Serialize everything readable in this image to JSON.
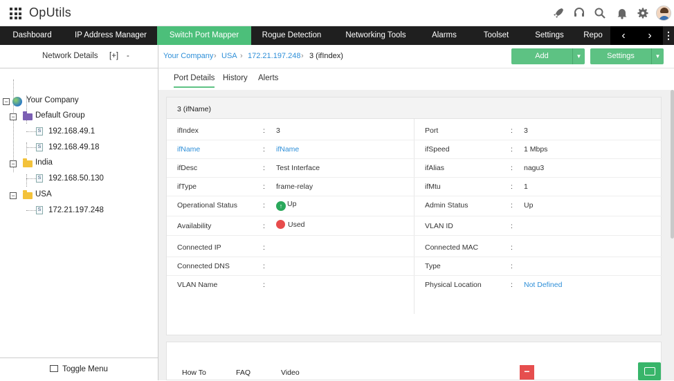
{
  "app": {
    "title": "OpUtils"
  },
  "header_icons": [
    "rocket-icon",
    "headset-icon",
    "search-icon",
    "bell-icon",
    "gear-icon"
  ],
  "nav": {
    "items": [
      "Dashboard",
      "IP Address Manager",
      "Switch Port Mapper",
      "Rogue Detection",
      "Networking Tools",
      "Alarms",
      "Toolset",
      "Settings",
      "Repo"
    ],
    "active": "Switch Port Mapper",
    "prev_arrow": "‹",
    "next_arrow": "›",
    "more": "⋮"
  },
  "sidebar": {
    "title": "Network Details",
    "expand": "[+]",
    "collapse": "-",
    "tree": {
      "root": "Your Company",
      "groups": [
        {
          "label": "Default Group",
          "color": "#7b5fb3",
          "children": [
            "192.168.49.1",
            "192.168.49.18"
          ]
        },
        {
          "label": "India",
          "color": "#f3c23a",
          "children": [
            "192.168.50.130"
          ]
        },
        {
          "label": "USA",
          "color": "#f3c23a",
          "children": [
            "172.21.197.248"
          ]
        }
      ]
    },
    "toggle_menu": "Toggle Menu"
  },
  "breadcrumb": {
    "items": [
      "Your Company",
      "USA",
      "172.21.197.248"
    ],
    "current": "3 (ifIndex)"
  },
  "buttons": {
    "add": "Add",
    "settings": "Settings"
  },
  "tabs": {
    "items": [
      "Port Details",
      "History",
      "Alerts"
    ],
    "active": "Port Details"
  },
  "port": {
    "heading": "3 (ifName)",
    "rows": [
      {
        "lk": "ifIndex",
        "lv": "3",
        "rk": "Port",
        "rv": "3"
      },
      {
        "lk": "ifName",
        "lv": "ifName",
        "rk": "ifSpeed",
        "rv": "1 Mbps"
      },
      {
        "lk": "ifDesc",
        "lv": "Test Interface",
        "rk": "ifAlias",
        "rv": "nagu3"
      },
      {
        "lk": "ifType",
        "lv": "frame-relay",
        "rk": "ifMtu",
        "rv": "1"
      },
      {
        "lk": "Operational Status",
        "lv": "Up",
        "rk": "Admin Status",
        "rv": "Up"
      },
      {
        "lk": "Availability",
        "lv": "Used",
        "rk": "VLAN ID",
        "rv": ""
      },
      {
        "lk": "Connected IP",
        "lv": "",
        "rk": "Connected MAC",
        "rv": ""
      },
      {
        "lk": "Connected DNS",
        "lv": "",
        "rk": "Type",
        "rv": ""
      },
      {
        "lk": "VLAN Name",
        "lv": "",
        "rk": "Physical Location",
        "rv": "Not Defined"
      }
    ],
    "separator": ":"
  },
  "footer": {
    "links": [
      "How To",
      "FAQ",
      "Video"
    ],
    "minimize": "−"
  },
  "colors": {
    "accent": "#4cbf7a",
    "link": "#2e8fd8",
    "status_up": "#2aa85b",
    "status_used": "#e74c4c"
  }
}
